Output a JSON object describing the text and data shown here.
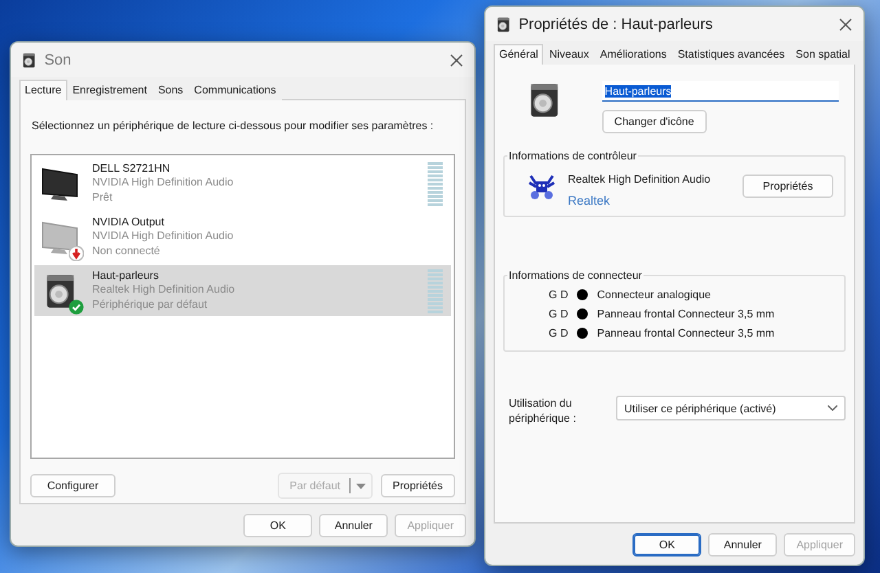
{
  "sound_window": {
    "title": "Son",
    "tabs": [
      {
        "label": "Lecture",
        "selected": true
      },
      {
        "label": "Enregistrement",
        "selected": false
      },
      {
        "label": "Sons",
        "selected": false
      },
      {
        "label": "Communications",
        "selected": false
      }
    ],
    "instruction": "Sélectionnez un périphérique de lecture ci-dessous pour modifier ses paramètres :",
    "devices": [
      {
        "kind": "monitor",
        "name": "DELL S2721HN",
        "driver": "NVIDIA High Definition Audio",
        "status": "Prêt",
        "connected": true,
        "is_default": false,
        "meter": true,
        "selected": false
      },
      {
        "kind": "monitor_off",
        "name": "NVIDIA Output",
        "driver": "NVIDIA High Definition Audio",
        "status": "Non connecté",
        "connected": false,
        "is_default": false,
        "meter": false,
        "selected": false
      },
      {
        "kind": "speaker",
        "name": "Haut-parleurs",
        "driver": "Realtek High Definition Audio",
        "status": "Périphérique par défaut",
        "connected": true,
        "is_default": true,
        "meter": true,
        "selected": true
      }
    ],
    "configure_button": "Configurer",
    "default_button": {
      "label": "Par défaut",
      "disabled": true
    },
    "properties_button": "Propriétés",
    "footer_buttons": [
      {
        "label": "OK",
        "disabled": false,
        "default": false
      },
      {
        "label": "Annuler",
        "disabled": false,
        "default": false
      },
      {
        "label": "Appliquer",
        "disabled": true,
        "default": false
      }
    ]
  },
  "properties_window": {
    "title": "Propriétés de : Haut-parleurs",
    "tabs": [
      {
        "label": "Général",
        "selected": true
      },
      {
        "label": "Niveaux",
        "selected": false
      },
      {
        "label": "Améliorations",
        "selected": false
      },
      {
        "label": "Statistiques avancées",
        "selected": false
      },
      {
        "label": "Son spatial",
        "selected": false
      }
    ],
    "name_field": "Haut-parleurs",
    "change_icon_button": "Changer d'icône",
    "controller_group": {
      "title": "Informations de contrôleur",
      "name": "Realtek High Definition Audio",
      "button": "Propriétés",
      "link": "Realtek"
    },
    "connector_group": {
      "title": "Informations de connecteur",
      "rows": [
        {
          "channels": "G D",
          "label": "Connecteur analogique"
        },
        {
          "channels": "G D",
          "label": "Panneau frontal Connecteur 3,5 mm"
        },
        {
          "channels": "G D",
          "label": "Panneau frontal Connecteur 3,5 mm"
        }
      ]
    },
    "usage_label": "Utilisation du périphérique :",
    "usage_value": "Utiliser ce périphérique (activé)",
    "footer_buttons": [
      {
        "label": "OK",
        "disabled": false,
        "default": true
      },
      {
        "label": "Annuler",
        "disabled": false,
        "default": false
      },
      {
        "label": "Appliquer",
        "disabled": true,
        "default": false
      }
    ]
  }
}
